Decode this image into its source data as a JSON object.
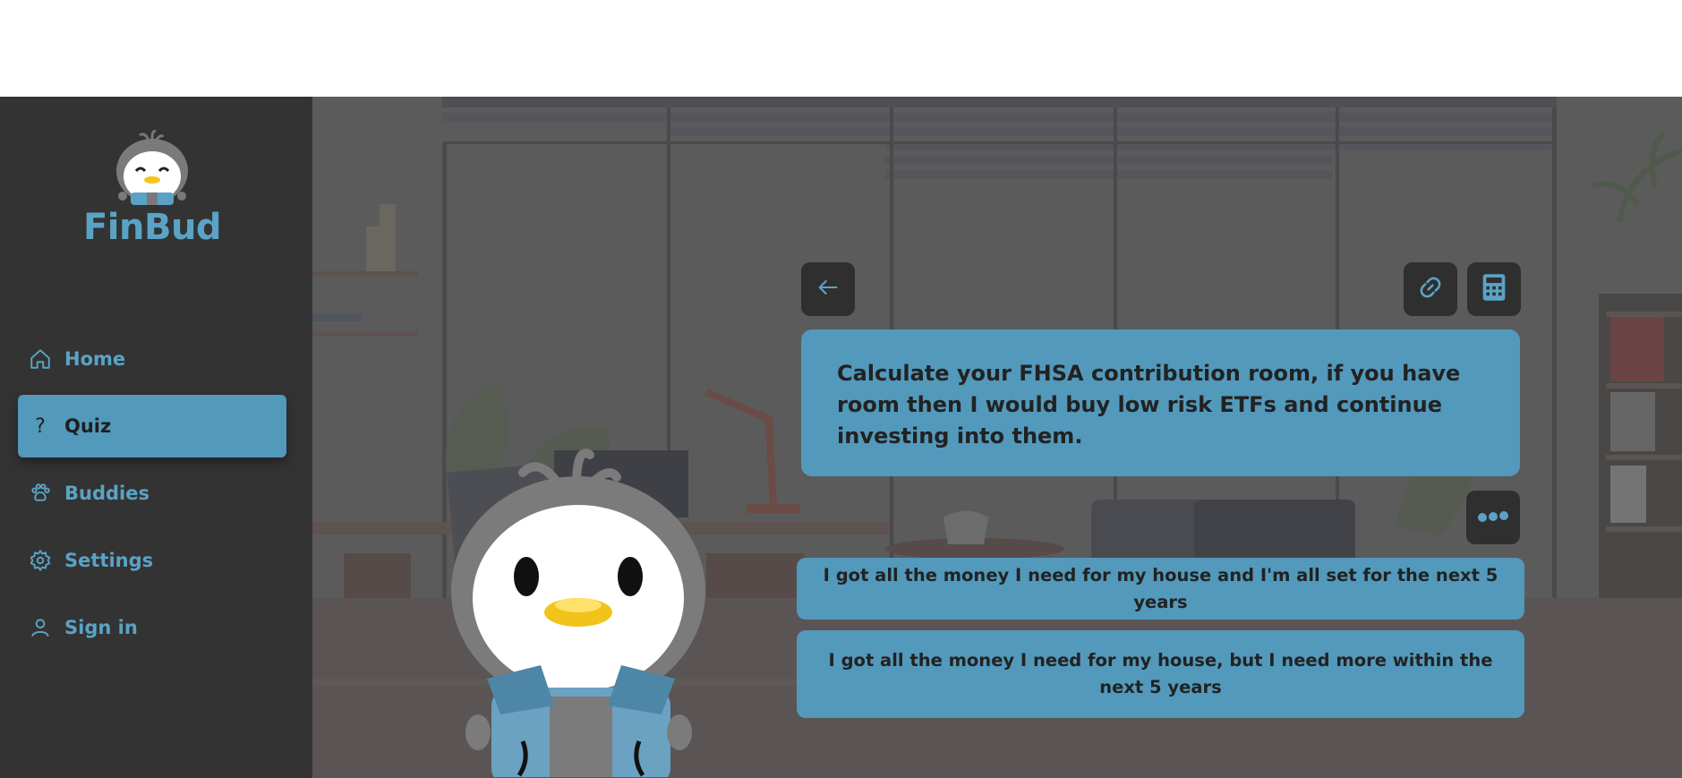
{
  "app": {
    "name": "FinBud"
  },
  "nav": {
    "items": [
      {
        "label": "Home",
        "icon": "home-icon"
      },
      {
        "label": "Quiz",
        "icon": "question-icon",
        "active": true
      },
      {
        "label": "Buddies",
        "icon": "paw-icon"
      },
      {
        "label": "Settings",
        "icon": "gear-icon"
      },
      {
        "label": "Sign in",
        "icon": "user-icon"
      }
    ]
  },
  "quiz": {
    "question": "Calculate your FHSA contribution room, if you have room then I would buy low risk ETFs and continue investing into them.",
    "answers": [
      "I got all the money I need for my house and I'm all set for the next 5 years",
      "I got all the money I need for my house, but I need more within the next 5 years"
    ]
  },
  "toolbar": {
    "back_icon": "arrow-left-icon",
    "link_icon": "link-icon",
    "calculator_icon": "calculator-icon",
    "more_icon": "more-dots-icon"
  },
  "colors": {
    "accent": "#5299bb",
    "accent_text": "#5aa3c6",
    "sidebar": "#333333",
    "button_dark": "#2f2f2f",
    "scene_overlay": "#5b5b5b"
  }
}
